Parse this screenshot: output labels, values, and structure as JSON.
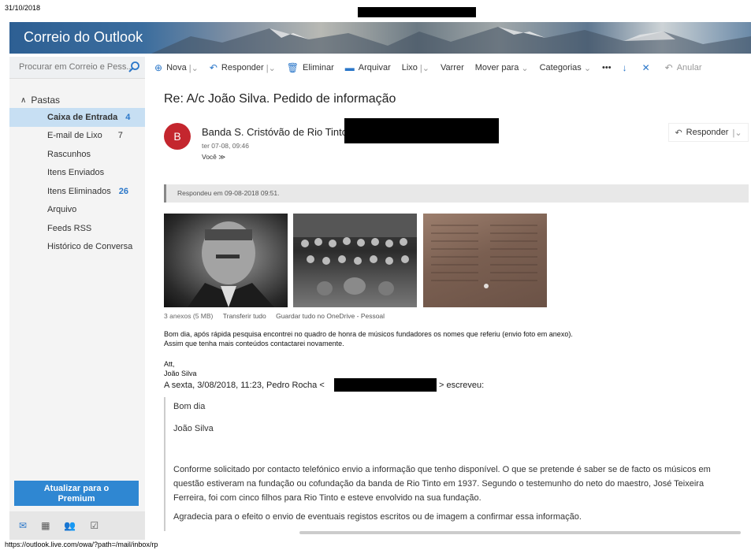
{
  "print": {
    "date": "31/10/2018",
    "url": "https://outlook.live.com/owa/?path=/mail/inbox/rp"
  },
  "app": {
    "title": "Correio do Outlook"
  },
  "search": {
    "placeholder": "Procurar em Correio e Pess..."
  },
  "toolbar": {
    "new_label": "Nova",
    "reply_label": "Responder",
    "delete_label": "Eliminar",
    "archive_label": "Arquivar",
    "junk_label": "Lixo",
    "sweep_label": "Varrer",
    "move_label": "Mover para",
    "categories_label": "Categorias",
    "more_label": "•••",
    "undo_label": "Anular"
  },
  "sidebar": {
    "folders_header": "Pastas",
    "folders": [
      {
        "label": "Caixa de Entrada",
        "count": "4"
      },
      {
        "label": "E-mail de Lixo",
        "count": "7"
      },
      {
        "label": "Rascunhos",
        "count": ""
      },
      {
        "label": "Itens Enviados",
        "count": ""
      },
      {
        "label": "Itens Eliminados",
        "count": "26"
      },
      {
        "label": "Arquivo",
        "count": ""
      },
      {
        "label": "Feeds RSS",
        "count": ""
      },
      {
        "label": "Histórico de Conversa",
        "count": ""
      }
    ],
    "premium_line1": "Atualizar para o",
    "premium_line2": "Premium"
  },
  "message": {
    "subject": "Re: A/c João Silva. Pedido de informação",
    "avatar_letter": "B",
    "sender": "Banda S. Cristóvão de Rio Tinto",
    "sent": "ter 07-08, 09:46",
    "to": "Você",
    "reply_button": "Responder",
    "replied_note": "Respondeu em 09-08-2018 09:51.",
    "attachments": {
      "count_size": "3 anexos (5 MB)",
      "download_all": "Transferir tudo",
      "save_onedrive": "Guardar tudo no OneDrive - Pessoal"
    },
    "body": {
      "line1": "Bom dia, após rápida pesquisa encontrei no quadro de honra de músicos fundadores os nomes que referiu (envio foto em anexo).",
      "line2": "Assim que tenha mais conteúdos contactarei novamente.",
      "signoff": "Att,",
      "signature": "João Silva"
    },
    "quote_header_start": "A sexta, 3/08/2018, 11:23, Pedro Rocha <",
    "quote_header_end": "> escreveu:",
    "quoted": {
      "greeting": "Bom dia",
      "addressee": "João Silva",
      "para1_line1": "Conforme solicitado por contacto telefónico envio a informação que tenho disponível. O que se pretende é saber se de facto os músicos em",
      "para1_line2": "questão estiveram na fundação ou cofundação da banda de Rio Tinto em 1937. Segundo o testemunho do neto do maestro, José Teixeira",
      "para1_line3": "Ferreira, foi com cinco filhos para Rio Tinto e esteve envolvido na sua fundação.",
      "para2": "Agradecia para o efeito o envio de eventuais registos escritos ou de imagem a confirmar essa informação."
    }
  }
}
